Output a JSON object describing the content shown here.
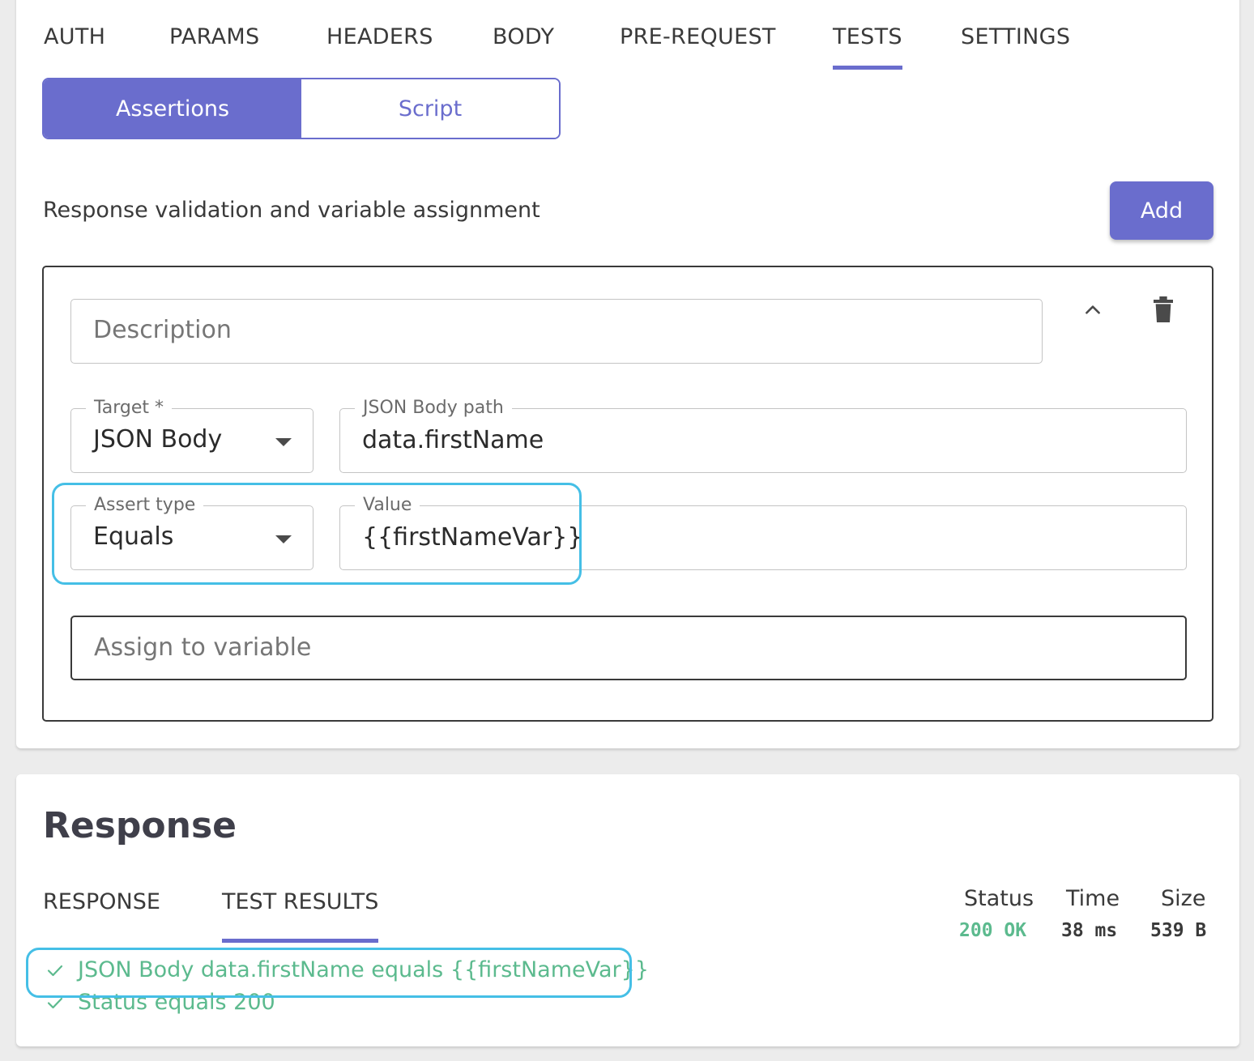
{
  "tabs": [
    {
      "label": "AUTH"
    },
    {
      "label": "PARAMS"
    },
    {
      "label": "HEADERS"
    },
    {
      "label": "BODY"
    },
    {
      "label": "PRE-REQUEST"
    },
    {
      "label": "TESTS",
      "active": true
    },
    {
      "label": "SETTINGS"
    }
  ],
  "mode_toggle": {
    "assertions_label": "Assertions",
    "script_label": "Script",
    "selected": "Assertions"
  },
  "tests": {
    "subtitle": "Response validation and variable assignment",
    "add_label": "Add",
    "assertion": {
      "description_placeholder": "Description",
      "target_label": "Target *",
      "target_value": "JSON Body",
      "path_label": "JSON Body path",
      "path_value": "data.firstName",
      "assert_type_label": "Assert type",
      "assert_type_value": "Equals",
      "value_label": "Value",
      "value_value": "{{firstNameVar}}",
      "assign_placeholder": "Assign to variable"
    }
  },
  "response": {
    "title": "Response",
    "tabs": [
      {
        "label": "RESPONSE"
      },
      {
        "label": "TEST RESULTS",
        "active": true
      }
    ],
    "stats": {
      "status_label": "Status",
      "status_value": "200 OK",
      "time_label": "Time",
      "time_value": "38 ms",
      "size_label": "Size",
      "size_value": "539 B"
    },
    "results": [
      {
        "text": "JSON Body data.firstName equals {{firstNameVar}}",
        "passed": true
      },
      {
        "text": "Status equals 200",
        "passed": true
      }
    ]
  },
  "colors": {
    "accent": "#6a6dcd",
    "success": "#5cba8e",
    "highlight": "#45bfe6"
  },
  "icons": [
    "chevron-up-icon",
    "trash-icon",
    "dropdown-caret-icon",
    "check-icon"
  ]
}
